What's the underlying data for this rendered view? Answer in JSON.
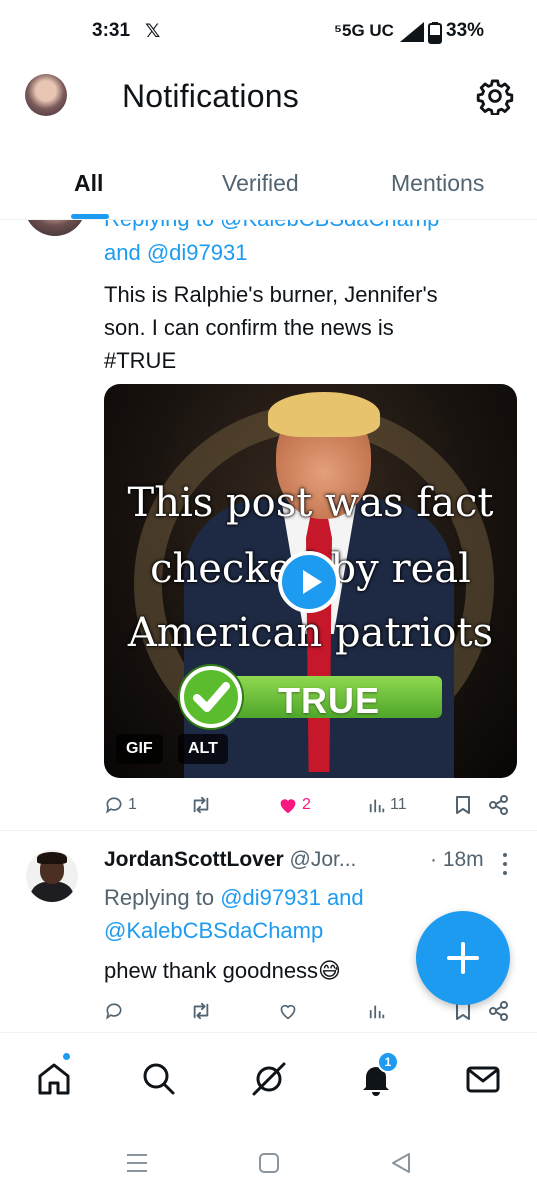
{
  "status_bar": {
    "time": "3:31",
    "x_label": "𝕏",
    "network": "⁵5G UC",
    "battery": "33%"
  },
  "header": {
    "title": "Notifications",
    "avatar_icon": "profile-avatar",
    "settings_icon": "gear-icon"
  },
  "tabs": [
    {
      "label": "All",
      "active": true
    },
    {
      "label": "Verified",
      "active": false
    },
    {
      "label": "Mentions",
      "active": false
    }
  ],
  "post1": {
    "replying_cut": "Replying to @KalebCBSdaChamp",
    "replying_and": "and ",
    "replying_handle2": "@di97931",
    "text_line1": "This is Ralphie's burner, Jennifer's",
    "text_line2": "son. I can confirm the news is",
    "hashtag": "#TRUE",
    "media": {
      "caption_line1": "This post was fact",
      "caption_line2": "checked by real",
      "caption_line3": "American patriots",
      "badge_text": "TRUE",
      "tag_gif": "GIF",
      "tag_alt": "ALT"
    },
    "actions": {
      "replies": "1",
      "reposts": "",
      "likes": "2",
      "views": "11",
      "liked_color": "#f91880"
    }
  },
  "post2": {
    "author_name": "JordanScottLover",
    "author_handle": "@Jor...",
    "time": "· 18m",
    "replying_prefix": "Replying to ",
    "replying_handle1": "@di97931",
    "replying_and": " and",
    "replying_handle2": "@KalebCBSdaChamp",
    "text": "phew thank goodness😅"
  },
  "fab": {
    "icon": "plus-icon"
  },
  "bottom_nav": {
    "items": [
      "home-icon",
      "search-icon",
      "grok-icon",
      "notifications-bell-icon",
      "messages-icon"
    ],
    "notification_count": "1"
  },
  "colors": {
    "accent": "#1d9bf0",
    "text": "#0f1419",
    "secondary": "#536471",
    "like": "#f91880"
  }
}
